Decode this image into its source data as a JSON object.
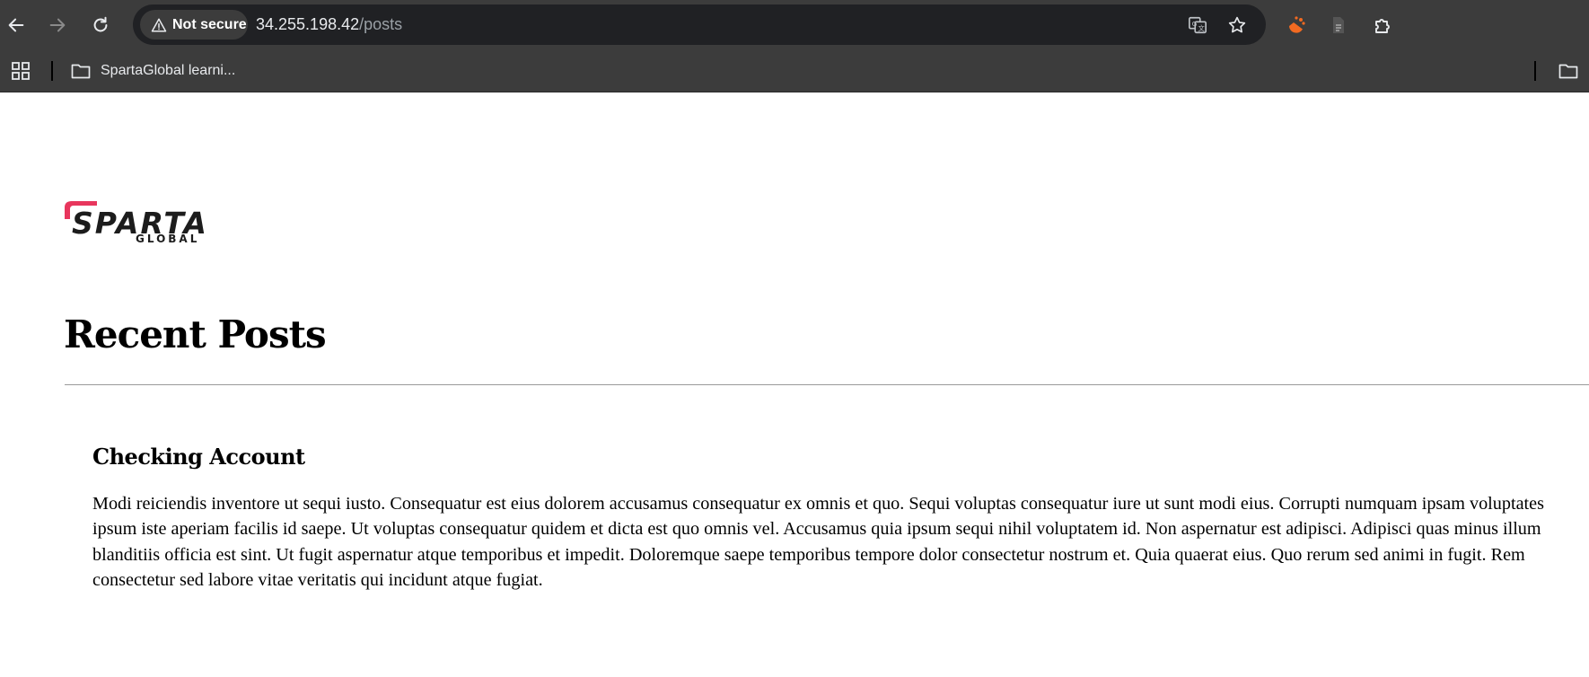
{
  "browser": {
    "security_label": "Not secure",
    "url_host": "34.255.198.42",
    "url_path": "/posts",
    "icons": {
      "back": "arrow-left-icon",
      "forward": "arrow-right-icon",
      "reload": "reload-icon",
      "warning": "warning-triangle-icon",
      "translate": "translate-icon",
      "bookmark": "star-icon",
      "extension1": "orange-extension-icon",
      "extension2": "document-extension-icon",
      "extensions": "puzzle-icon"
    },
    "bookmarks": {
      "folder_label": "SpartaGlobal learni..."
    }
  },
  "page": {
    "logo": {
      "word": "SPARTA",
      "sub": "GLOBAL",
      "accent_color": "#e8365d"
    },
    "heading": "Recent Posts",
    "posts": [
      {
        "title": "Checking Account",
        "body": "Modi reiciendis inventore ut sequi iusto. Consequatur est eius dolorem accusamus consequatur ex omnis et quo. Sequi voluptas consequatur iure ut sunt modi eius. Corrupti numquam ipsam voluptates ipsum iste aperiam facilis id saepe. Ut voluptas consequatur quidem et dicta est quo omnis vel. Accusamus quia ipsum sequi nihil voluptatem id. Non aspernatur est adipisci. Adipisci quas minus illum blanditiis officia est sint. Ut fugit aspernatur atque temporibus et impedit. Doloremque saepe temporibus tempore dolor consectetur nostrum et. Quia quaerat eius. Quo rerum sed animi in fugit. Rem consectetur sed labore vitae veritatis qui incidunt atque fugiat."
      }
    ]
  }
}
